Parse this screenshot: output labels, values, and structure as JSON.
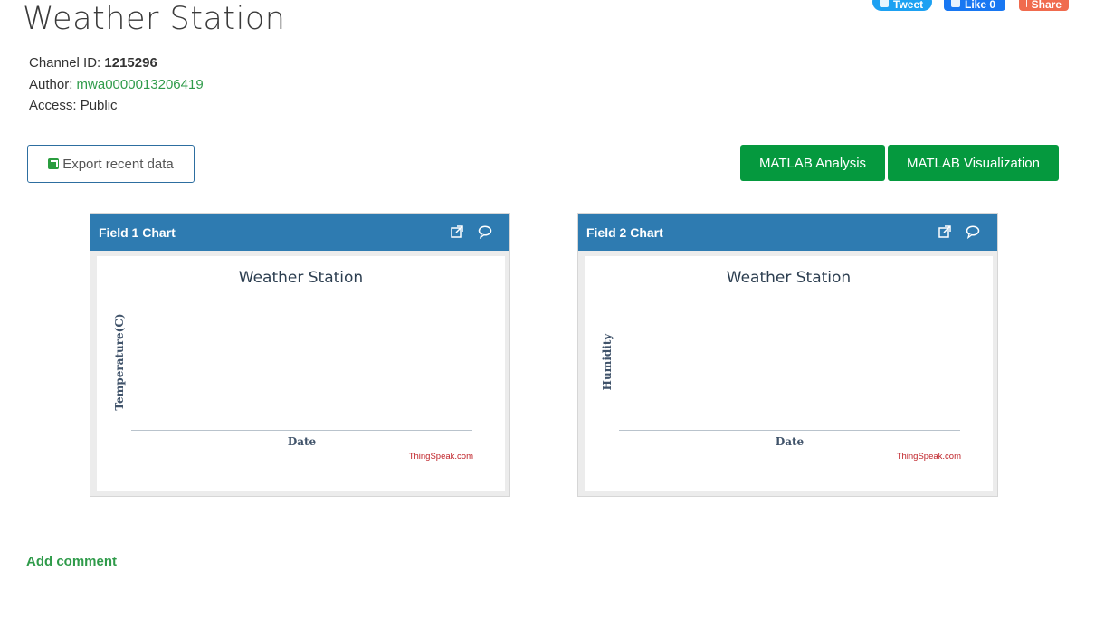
{
  "page": {
    "title": "Weather Station"
  },
  "social": {
    "tweet": "Tweet",
    "like": "Like 0",
    "share": "Share"
  },
  "meta": {
    "channel_label": "Channel ID:",
    "channel_id": "1215296",
    "author_label": "Author:",
    "author": "mwa0000013206419",
    "access_label": "Access:",
    "access": "Public"
  },
  "actions": {
    "export": "Export recent data",
    "matlab_analysis": "MATLAB Analysis",
    "matlab_visualization": "MATLAB Visualization"
  },
  "panels": [
    {
      "header": "Field 1 Chart",
      "title": "Weather Station",
      "ylabel": "Temperature(C)",
      "xlabel": "Date",
      "credit": "ThingSpeak.com"
    },
    {
      "header": "Field 2 Chart",
      "title": "Weather Station",
      "ylabel": "Humidity",
      "xlabel": "Date",
      "credit": "ThingSpeak.com"
    }
  ],
  "comments": {
    "add": "Add comment"
  },
  "colors": {
    "header_blue": "#2e7bb1",
    "green": "#05993e",
    "link_green": "#2f9b4a",
    "credit_red": "#c0242a"
  },
  "icons": {
    "popout": "external-link-icon",
    "comment": "comment-bubble-icon",
    "export": "export-icon"
  }
}
